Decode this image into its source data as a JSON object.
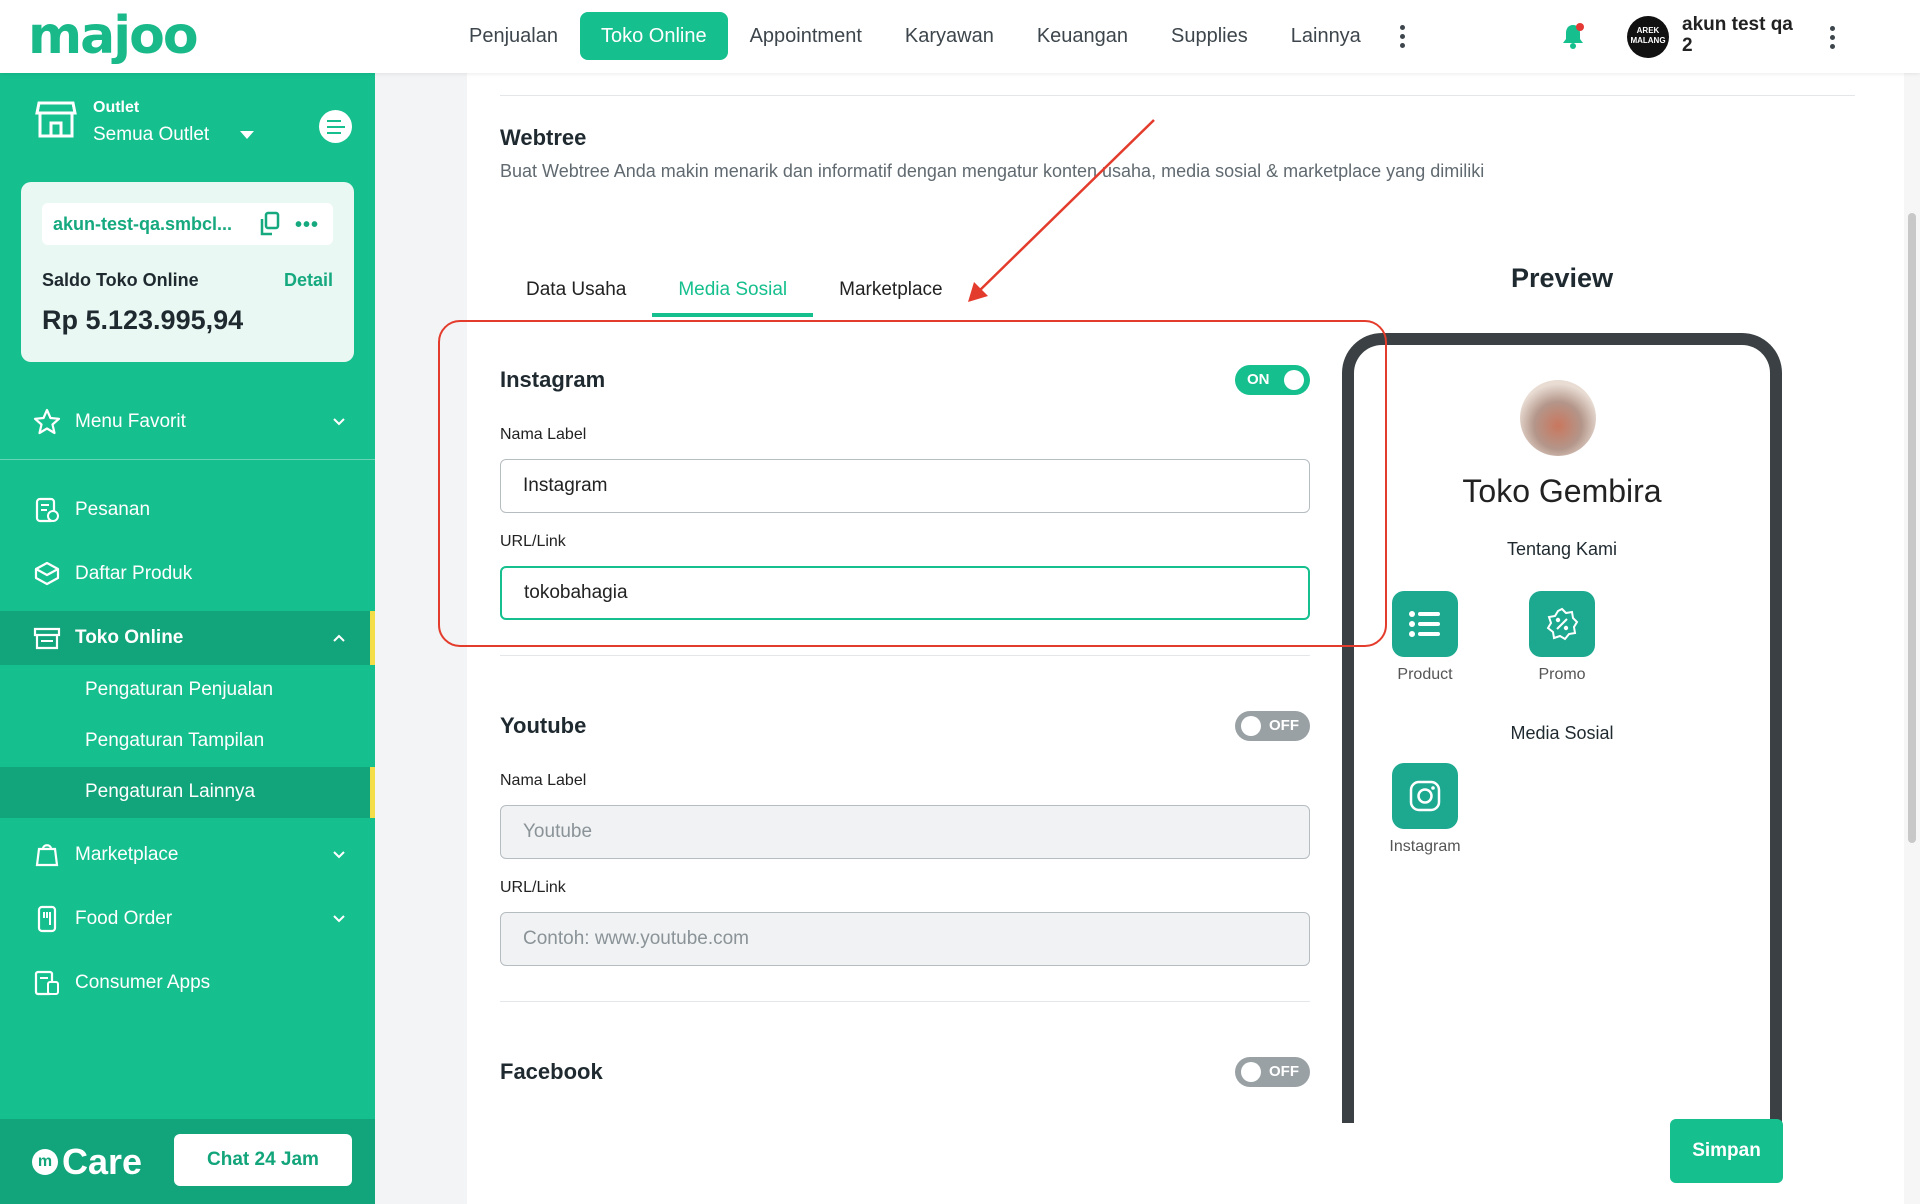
{
  "brand": {
    "logo": "majoo"
  },
  "nav": {
    "items": [
      "Penjualan",
      "Toko Online",
      "Appointment",
      "Karyawan",
      "Keuangan",
      "Supplies",
      "Lainnya"
    ],
    "active": "Toko Online"
  },
  "user": {
    "avatar_text": "AREK MALANG",
    "name": "akun test qa 2"
  },
  "sidebar": {
    "outlet_label": "Outlet",
    "outlet_value": "Semua Outlet",
    "shop_url": "akun-test-qa.smbcl...",
    "saldo_label": "Saldo Toko Online",
    "saldo_detail": "Detail",
    "saldo_value": "Rp 5.123.995,94",
    "menu_favorit": "Menu Favorit",
    "items": [
      {
        "label": "Pesanan",
        "icon": "order-icon"
      },
      {
        "label": "Daftar Produk",
        "icon": "product-box-icon"
      },
      {
        "label": "Toko Online",
        "icon": "storefront-icon"
      }
    ],
    "sub_items": [
      "Pengaturan Penjualan",
      "Pengaturan Tampilan",
      "Pengaturan Lainnya"
    ],
    "lower_items": [
      {
        "label": "Marketplace",
        "icon": "marketplace-icon"
      },
      {
        "label": "Food Order",
        "icon": "food-order-icon"
      },
      {
        "label": "Consumer Apps",
        "icon": "consumer-apps-icon"
      }
    ],
    "care_label": "Care",
    "chat_button": "Chat 24 Jam"
  },
  "content": {
    "title": "Webtree",
    "description": "Buat Webtree Anda makin menarik dan informatif dengan mengatur konten usaha, media sosial & marketplace yang dimiliki",
    "tabs": [
      "Data Usaha",
      "Media Sosial",
      "Marketplace"
    ],
    "active_tab": "Media Sosial",
    "label_nama": "Nama Label",
    "label_url": "URL/Link",
    "instagram": {
      "title": "Instagram",
      "toggle": "ON",
      "nama_value": "Instagram",
      "url_value": "tokobahagia"
    },
    "youtube": {
      "title": "Youtube",
      "toggle": "OFF",
      "nama_placeholder": "Youtube",
      "url_placeholder": "Contoh: www.youtube.com"
    },
    "facebook": {
      "title": "Facebook",
      "toggle": "OFF"
    },
    "save_button": "Simpan"
  },
  "preview": {
    "title": "Preview",
    "shop_name": "Toko Gembira",
    "about": "Tentang Kami",
    "tiles": [
      "Product",
      "Promo"
    ],
    "media_title": "Media Sosial",
    "media_tiles": [
      "Instagram"
    ]
  },
  "colors": {
    "accent": "#16bf8e",
    "annotation": "#e43c2c"
  }
}
